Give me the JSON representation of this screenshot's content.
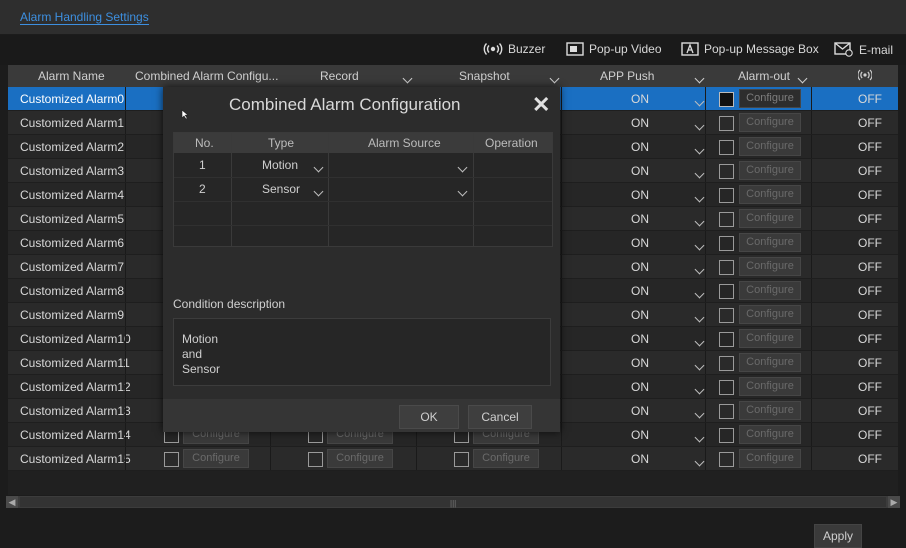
{
  "window": {
    "title": "Alarm Handling Settings"
  },
  "toolbar": {
    "buzzer": "Buzzer",
    "popup_video": "Pop-up Video",
    "popup_message": "Pop-up Message Box",
    "email": "E-mail"
  },
  "table": {
    "headers": {
      "alarm_name": "Alarm Name",
      "combined": "Combined Alarm Configu...",
      "record": "Record",
      "snapshot": "Snapshot",
      "app_push": "APP Push",
      "alarm_out": "Alarm-out",
      "buzzer_icon": "buzzer-icon"
    },
    "configure_label": "Configure",
    "rows": [
      {
        "name": "Customized Alarm0",
        "app_push": "ON",
        "last": "OFF"
      },
      {
        "name": "Customized Alarm1",
        "app_push": "ON",
        "last": "OFF"
      },
      {
        "name": "Customized Alarm2",
        "app_push": "ON",
        "last": "OFF"
      },
      {
        "name": "Customized Alarm3",
        "app_push": "ON",
        "last": "OFF"
      },
      {
        "name": "Customized Alarm4",
        "app_push": "ON",
        "last": "OFF"
      },
      {
        "name": "Customized Alarm5",
        "app_push": "ON",
        "last": "OFF"
      },
      {
        "name": "Customized Alarm6",
        "app_push": "ON",
        "last": "OFF"
      },
      {
        "name": "Customized Alarm7",
        "app_push": "ON",
        "last": "OFF"
      },
      {
        "name": "Customized Alarm8",
        "app_push": "ON",
        "last": "OFF"
      },
      {
        "name": "Customized Alarm9",
        "app_push": "ON",
        "last": "OFF"
      },
      {
        "name": "Customized Alarm10",
        "app_push": "ON",
        "last": "OFF"
      },
      {
        "name": "Customized Alarm11",
        "app_push": "ON",
        "last": "OFF"
      },
      {
        "name": "Customized Alarm12",
        "app_push": "ON",
        "last": "OFF"
      },
      {
        "name": "Customized Alarm13",
        "app_push": "ON",
        "last": "OFF"
      },
      {
        "name": "Customized Alarm14",
        "app_push": "ON",
        "last": "OFF"
      },
      {
        "name": "Customized Alarm15",
        "app_push": "ON",
        "last": "OFF"
      }
    ]
  },
  "apply_label": "Apply",
  "modal": {
    "title": "Combined Alarm Configuration",
    "columns": {
      "no": "No.",
      "type": "Type",
      "source": "Alarm Source",
      "operation": "Operation"
    },
    "rows": [
      {
        "no": "1",
        "type": "Motion",
        "source": ""
      },
      {
        "no": "2",
        "type": "Sensor",
        "source": ""
      }
    ],
    "condition_label": "Condition description",
    "condition_lines": [
      "Motion",
      "and",
      "Sensor"
    ],
    "ok_label": "OK",
    "cancel_label": "Cancel"
  },
  "colors": {
    "accent": "#1a6fc2",
    "link": "#3d8fe0"
  }
}
